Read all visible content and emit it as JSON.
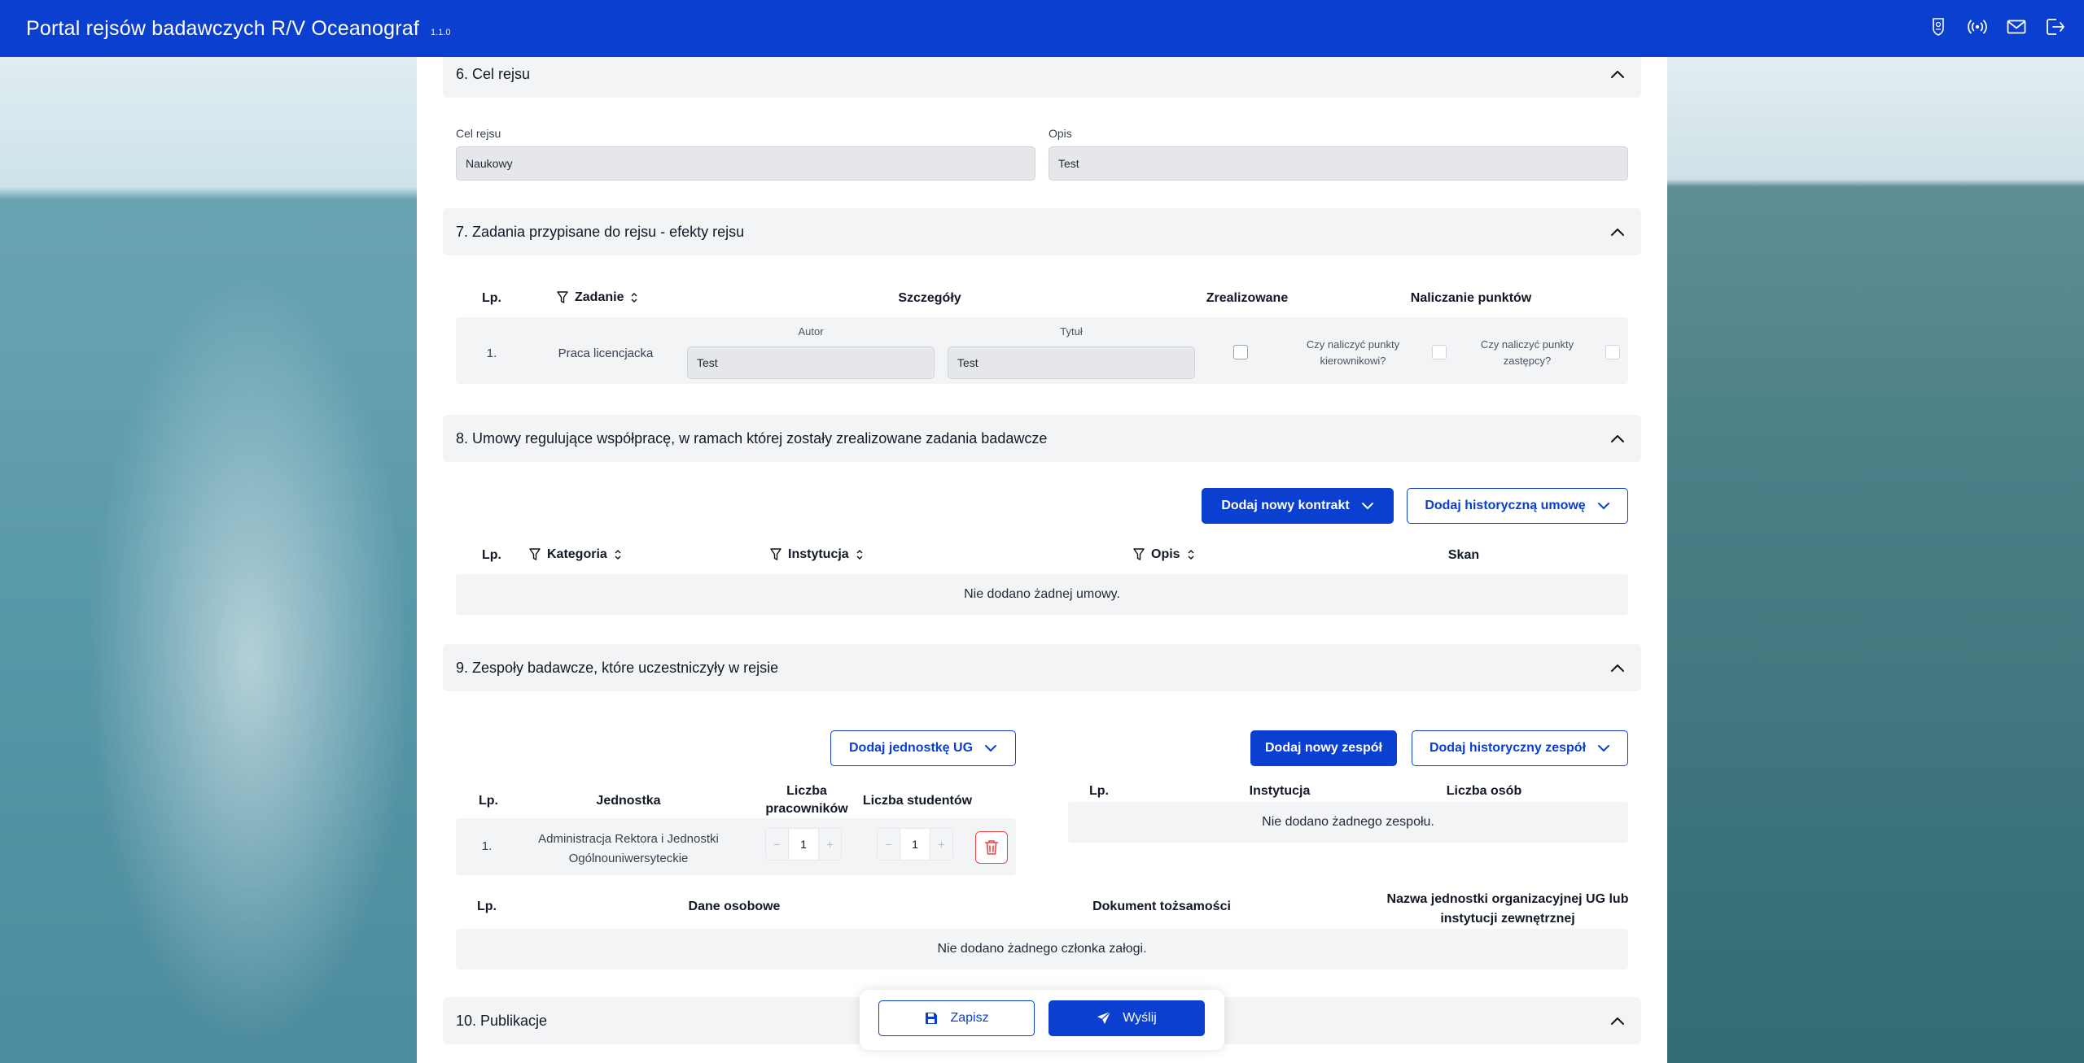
{
  "header": {
    "title": "Portal rejsów badawczych R/V Oceanograf",
    "version": "1.1.0",
    "icons": [
      "crest-icon",
      "broadcast-icon",
      "mail-icon",
      "logout-icon"
    ]
  },
  "section6": {
    "title": "6. Cel rejsu",
    "cel_label": "Cel rejsu",
    "cel_value": "Naukowy",
    "opis_label": "Opis",
    "opis_value": "Test"
  },
  "section7": {
    "title": "7. Zadania przypisane do rejsu - efekty rejsu",
    "headers": {
      "lp": "Lp.",
      "zadanie": "Zadanie",
      "szczegoly": "Szczegóły",
      "zrealizowane": "Zrealizowane",
      "punkty": "Naliczanie punktów"
    },
    "row": {
      "lp": "1.",
      "zadanie": "Praca licencjacka",
      "autor_label": "Autor",
      "autor_value": "Test",
      "tytul_label": "Tytuł",
      "tytul_value": "Test",
      "kier_q": "Czy naliczyć punkty kierownikowi?",
      "zast_q": "Czy naliczyć punkty zastępcy?"
    }
  },
  "section8": {
    "title": "8. Umowy regulujące współpracę, w ramach której zostały zrealizowane zadania badawcze",
    "btn_new": "Dodaj nowy kontrakt",
    "btn_hist": "Dodaj historyczną umowę",
    "headers": {
      "lp": "Lp.",
      "kategoria": "Kategoria",
      "instytucja": "Instytucja",
      "opis": "Opis",
      "skan": "Skan"
    },
    "empty": "Nie dodano żadnej umowy."
  },
  "section9": {
    "title": "9. Zespoły badawcze, które uczestniczyły w rejsie",
    "btn_unit": "Dodaj jednostkę UG",
    "btn_new_team": "Dodaj nowy zespół",
    "btn_hist_team": "Dodaj historyczny zespół",
    "units_headers": {
      "lp": "Lp.",
      "jednostka": "Jednostka",
      "pracownicy": "Liczba pracowników",
      "studenci": "Liczba studentów"
    },
    "unit_row": {
      "lp": "1.",
      "name": "Administracja Rektora i Jednostki Ogólnouniwersyteckie",
      "pracownicy": "1",
      "studenci": "1"
    },
    "teams_headers": {
      "lp": "Lp.",
      "instytucja": "Instytucja",
      "osoby": "Liczba osób"
    },
    "teams_empty": "Nie dodano żadnego zespołu.",
    "crew_headers": {
      "lp": "Lp.",
      "dane": "Dane osobowe",
      "dokument": "Dokument tożsamości",
      "jednostka": "Nazwa jednostki organizacyjnej UG lub instytucji zewnętrznej"
    },
    "crew_empty": "Nie dodano żadnego członka załogi."
  },
  "section10": {
    "title": "10. Publikacje"
  },
  "footer": {
    "save": "Zapisz",
    "send": "Wyślij"
  },
  "stepper": {
    "minus": "−",
    "plus": "+"
  }
}
